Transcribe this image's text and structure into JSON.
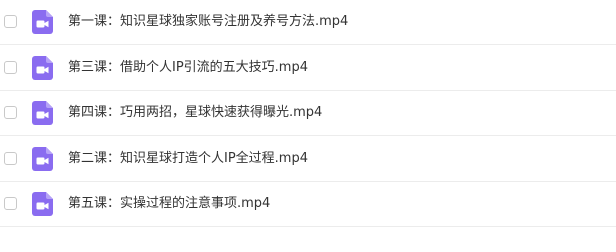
{
  "files": [
    {
      "name": "第一课：知识星球独家账号注册及养号方法.mp4",
      "icon": "video-file-icon"
    },
    {
      "name": "第三课：借助个人IP引流的五大技巧.mp4",
      "icon": "video-file-icon"
    },
    {
      "name": "第四课：巧用两招，星球快速获得曝光.mp4",
      "icon": "video-file-icon"
    },
    {
      "name": "第二课：知识星球打造个人IP全过程.mp4",
      "icon": "video-file-icon"
    },
    {
      "name": "第五课：实操过程的注意事项.mp4",
      "icon": "video-file-icon"
    }
  ],
  "colors": {
    "icon_bg": "#8a6cf0",
    "text": "#333333",
    "divider": "#ececec",
    "checkbox_border": "#c9c9c9"
  }
}
